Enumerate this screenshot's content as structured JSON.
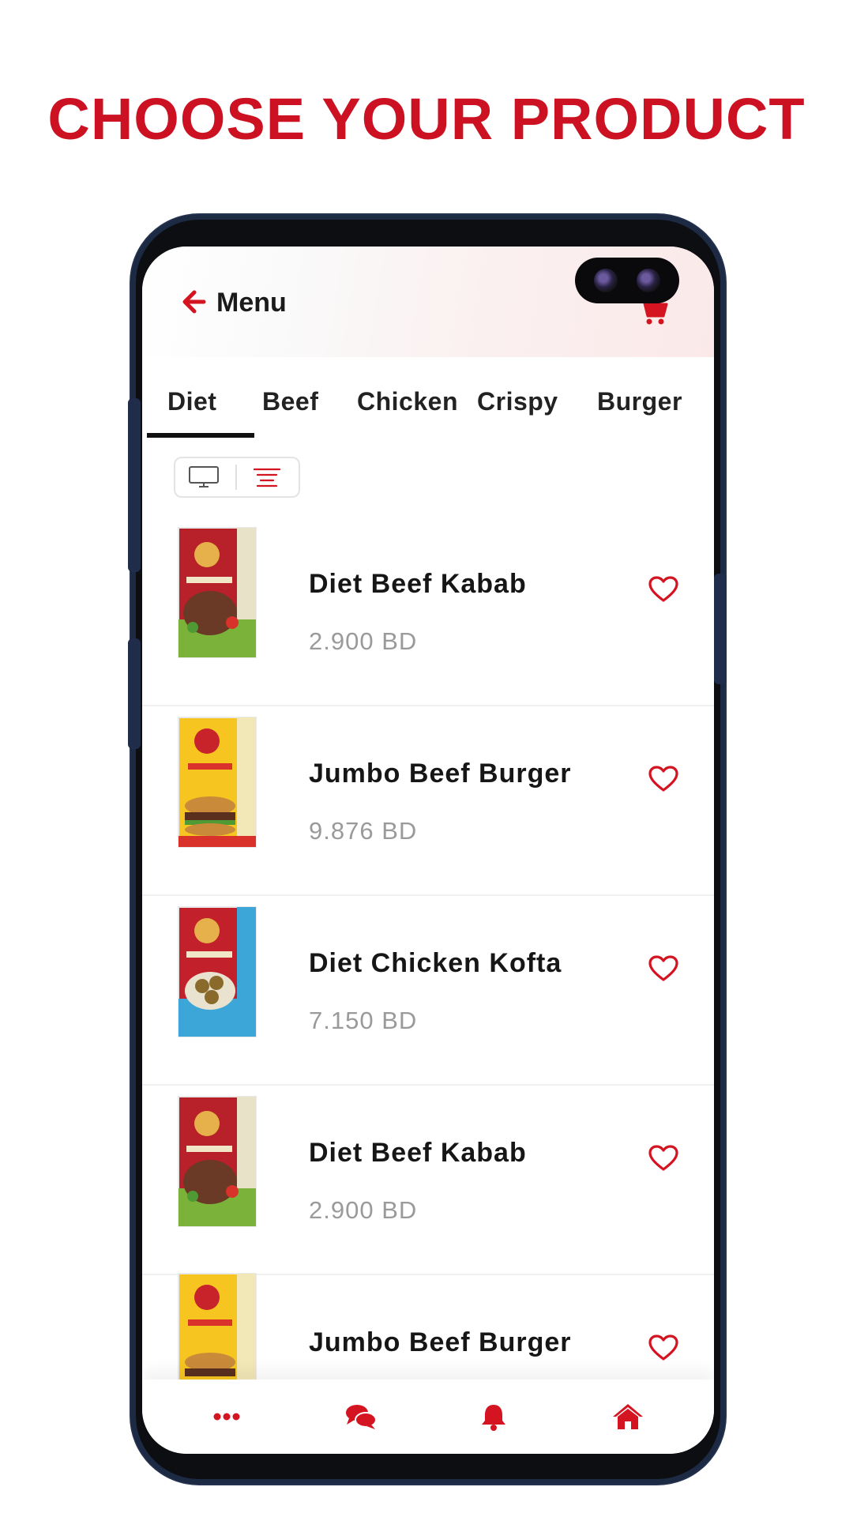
{
  "headline": {
    "text": "CHOOSE YOUR PRODUCT",
    "color": "#cc1222"
  },
  "theme": {
    "accent": "#d41420",
    "text": "#161616",
    "muted": "#9a9a9a"
  },
  "header": {
    "title": "Menu",
    "back_icon": "arrow-left-icon",
    "cart_icon": "cart-icon"
  },
  "tabs": [
    {
      "label": "Diet",
      "active": true
    },
    {
      "label": "Beef",
      "active": false
    },
    {
      "label": "Chicken",
      "active": false
    },
    {
      "label": "Crispy",
      "active": false
    },
    {
      "label": "Burger",
      "active": false
    }
  ],
  "view_toggle": {
    "options": [
      "monitor-icon",
      "list-icon"
    ],
    "selected": "list-icon"
  },
  "products": [
    {
      "name": "Diet Beef Kabab",
      "price": "2.900 BD",
      "favorite_icon": "heart-icon"
    },
    {
      "name": "Jumbo Beef Burger",
      "price": "9.876 BD",
      "favorite_icon": "heart-icon"
    },
    {
      "name": "Diet Chicken Kofta",
      "price": "7.150 BD",
      "favorite_icon": "heart-icon"
    },
    {
      "name": "Diet Beef Kabab",
      "price": "2.900 BD",
      "favorite_icon": "heart-icon"
    },
    {
      "name": "Jumbo Beef Burger",
      "price": "",
      "favorite_icon": "heart-icon"
    }
  ],
  "bottom_nav": [
    {
      "icon": "more-icon"
    },
    {
      "icon": "chat-icon"
    },
    {
      "icon": "bell-icon"
    },
    {
      "icon": "home-icon"
    }
  ]
}
